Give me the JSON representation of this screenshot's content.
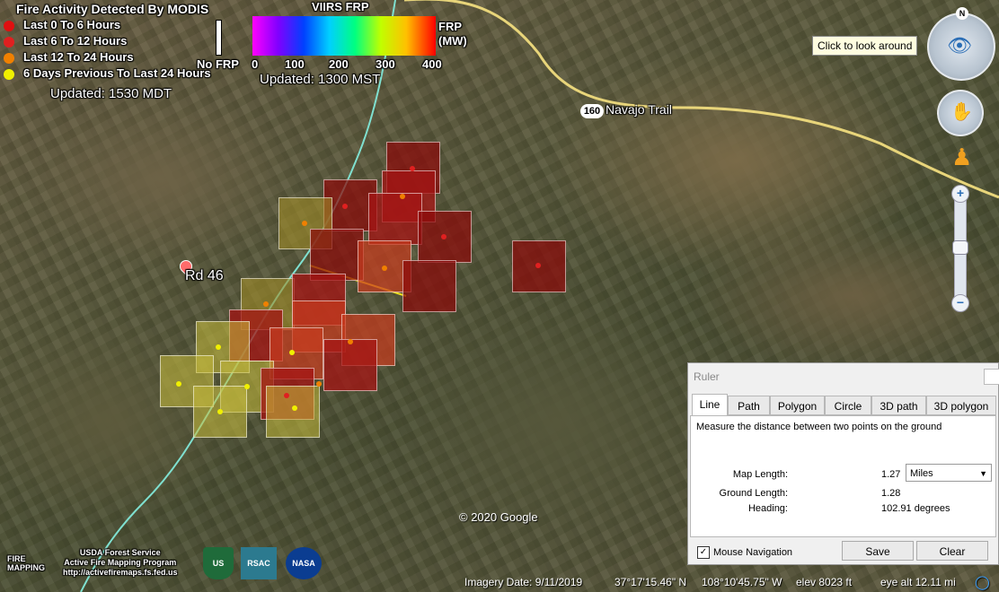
{
  "modis_legend": {
    "title": "Fire Activity Detected By MODIS",
    "items": [
      {
        "label": "Last 0 To 6 Hours",
        "color": "#e01010"
      },
      {
        "label": "Last 6 To 12 Hours",
        "color": "#e02020"
      },
      {
        "label": "Last 12 To 24 Hours",
        "color": "#f08000"
      },
      {
        "label": "6 Days Previous To Last 24 Hours",
        "color": "#f0f000"
      }
    ],
    "updated": "Updated: 1530 MDT"
  },
  "viirs_legend": {
    "title": "VIIRS FRP",
    "no_frp": "No FRP",
    "unit": "FRP\n(MW)",
    "ticks": [
      "0",
      "100",
      "200",
      "300",
      "400"
    ],
    "updated": "Updated: 1300 MST"
  },
  "map_labels": {
    "road_shield": "160",
    "road_name": "Navajo Trail",
    "rd46": "Rd 46",
    "copyright": "© 2020 Google"
  },
  "nav_controls": {
    "compass_north": "N",
    "tooltip": "Click to look around",
    "zoom_in": "+",
    "zoom_out": "−"
  },
  "ruler": {
    "title": "Ruler",
    "tabs": [
      "Line",
      "Path",
      "Polygon",
      "Circle",
      "3D path",
      "3D polygon"
    ],
    "active_tab": "Line",
    "description": "Measure the distance between two points on the ground",
    "map_length_label": "Map Length:",
    "map_length_value": "1.27",
    "units": "Miles",
    "ground_length_label": "Ground Length:",
    "ground_length_value": "1.28",
    "heading_label": "Heading:",
    "heading_value": "102.91 degrees",
    "mouse_navigation_label": "Mouse Navigation",
    "mouse_navigation_checked": "✓",
    "save_label": "Save",
    "clear_label": "Clear"
  },
  "status_bar": {
    "imagery_date": "Imagery Date: 9/11/2019",
    "lat": "37°17'15.46\" N",
    "lon": "108°10'45.75\" W",
    "elev": "elev  8023 ft",
    "eye_alt": "eye alt  12.11 mi"
  },
  "credits": {
    "line1": "USDA Forest Service",
    "line2": "Active Fire Mapping Program",
    "line3": "http://activefiremaps.fs.fed.us",
    "logo_fire": "FIRE MAPPING",
    "logo_usfs": "US",
    "logo_rsac": "RSAC",
    "logo_nasa": "NASA"
  }
}
